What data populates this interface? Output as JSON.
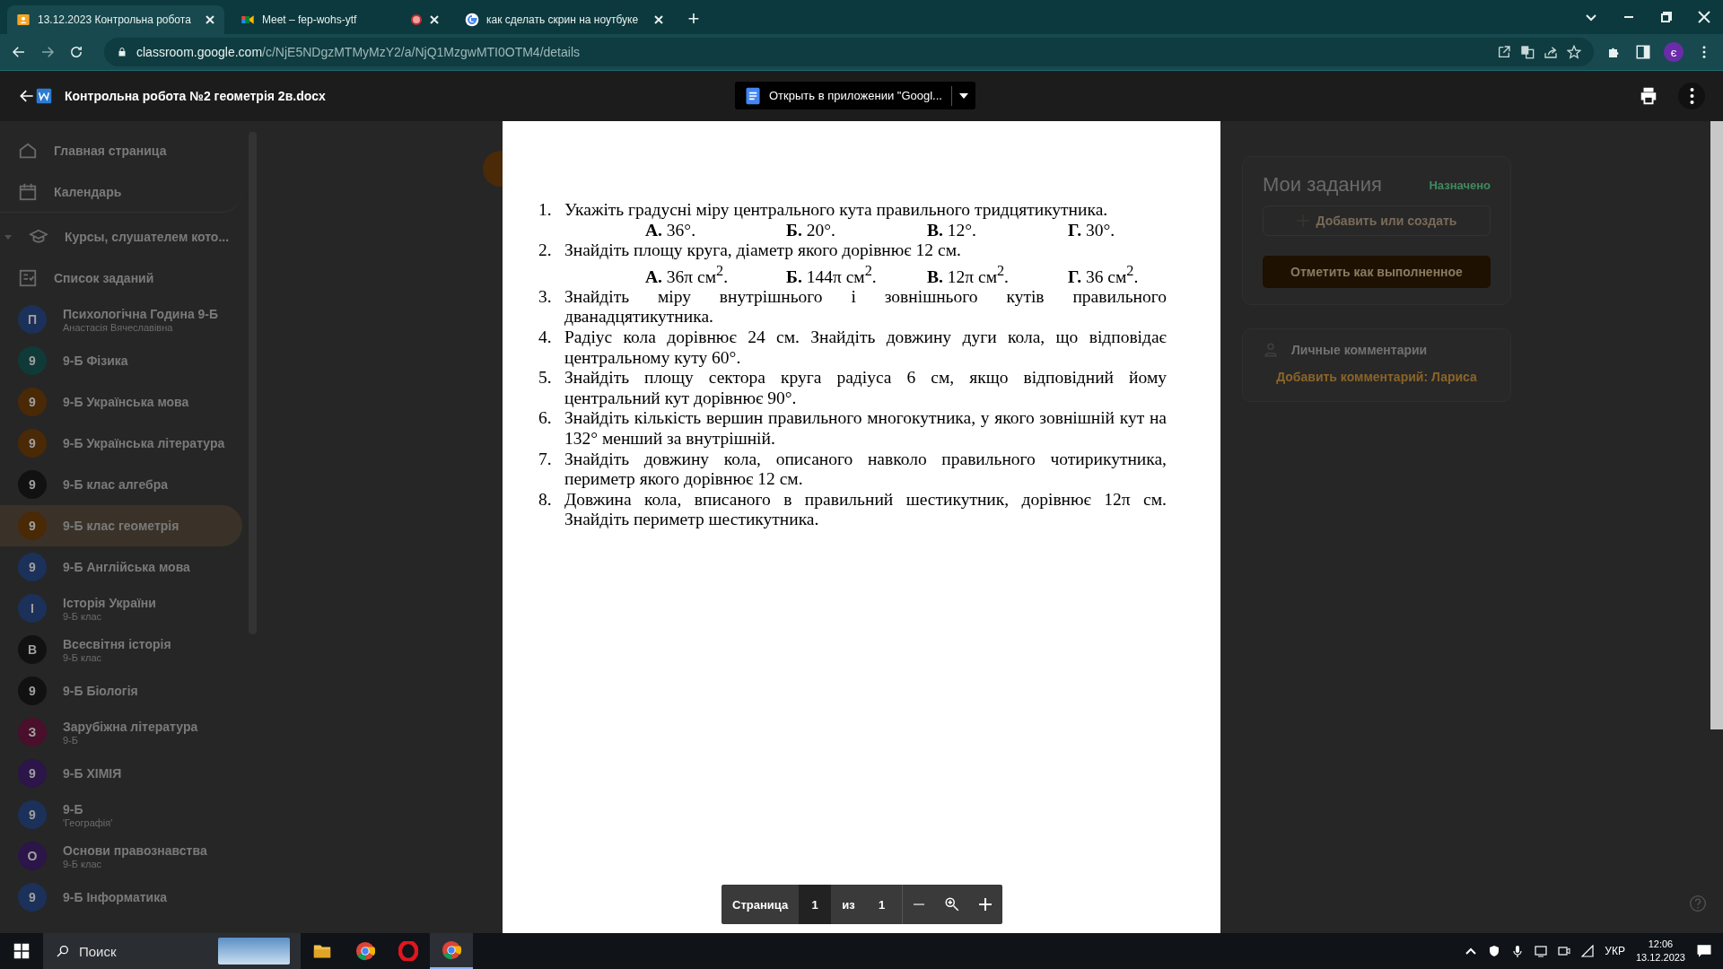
{
  "browser": {
    "tabs": [
      {
        "title": "13.12.2023 Контрольна робота",
        "selected": true,
        "kind": "classroom",
        "recording": false
      },
      {
        "title": "Meet – fep-wohs-ytf",
        "selected": false,
        "kind": "meet",
        "recording": true
      },
      {
        "title": "как сделать скрин на ноутбуке",
        "selected": false,
        "kind": "google",
        "recording": false
      }
    ],
    "new_tab": "+",
    "url_host": "classroom.google.com",
    "url_path": "/c/NjE5NDgzMTMyMzY2/a/NjQ1MzgwMTI0OTM4/details",
    "profile": "є"
  },
  "viewer": {
    "file_name": "Контрольна робота №2 геометрія 2в.docx",
    "open_button": "Открыть в приложении \"Googl...",
    "page_label": "Страница",
    "page": "1",
    "of": "из",
    "pages": "1"
  },
  "sidebar": {
    "items": [
      {
        "kind": "home",
        "label": "Главная страница",
        "selected": false
      },
      {
        "kind": "calendar",
        "label": "Календарь",
        "selected": false
      },
      {
        "kind": "courses",
        "label": "Курсы, слушателем кото...",
        "selected": false,
        "expanded": true
      },
      {
        "kind": "todo",
        "label": "Список заданий",
        "selected": false
      },
      {
        "kind": "course",
        "letter": "П",
        "color": "#1b3159",
        "label": "Психологічна Година 9-Б",
        "subtitle": "Анастасія Вячеславівна",
        "selected": false
      },
      {
        "kind": "course",
        "letter": "9",
        "color": "#0f3a38",
        "label": "9-Б Фізика",
        "selected": false
      },
      {
        "kind": "course",
        "letter": "9",
        "color": "#4a2906",
        "label": "9-Б Українська мова",
        "selected": false
      },
      {
        "kind": "course",
        "letter": "9",
        "color": "#4a2906",
        "label": "9-Б Українська література",
        "selected": false
      },
      {
        "kind": "course",
        "letter": "9",
        "color": "#111111",
        "label": "9-Б клас алгебра",
        "selected": false
      },
      {
        "kind": "course",
        "letter": "9",
        "color": "#4a2906",
        "label": "9-Б клас геометрія",
        "selected": true
      },
      {
        "kind": "course",
        "letter": "9",
        "color": "#1b3159",
        "label": "9-Б Англійська мова",
        "selected": false
      },
      {
        "kind": "course",
        "letter": "І",
        "color": "#1b3159",
        "label": "Історія України",
        "subtitle": "9-Б клас",
        "selected": false
      },
      {
        "kind": "course",
        "letter": "В",
        "color": "#111111",
        "label": "Всесвітня історія",
        "subtitle": "9-Б клас",
        "selected": false
      },
      {
        "kind": "course",
        "letter": "9",
        "color": "#111111",
        "label": "9-Б Біологія",
        "selected": false
      },
      {
        "kind": "course",
        "letter": "З",
        "color": "#4a0f2b",
        "label": "Зарубіжна література",
        "subtitle": "9-Б",
        "selected": false
      },
      {
        "kind": "course",
        "letter": "9",
        "color": "#2c1548",
        "label": "9-Б ХІМІЯ",
        "selected": false
      },
      {
        "kind": "course",
        "letter": "9",
        "color": "#1b3159",
        "label": "9-Б",
        "subtitle": "'Географія'",
        "selected": false
      },
      {
        "kind": "course",
        "letter": "О",
        "color": "#2c1548",
        "label": "Основи правознавства",
        "subtitle": "9-Б клас",
        "selected": false
      },
      {
        "kind": "course",
        "letter": "9",
        "color": "#1b3159",
        "label": "9-Б Інформатика",
        "selected": false
      }
    ]
  },
  "document": {
    "questions": [
      {
        "number": "1.",
        "text": "Укажіть градусні міру центрального кута правильного тридцятикутника.",
        "options": [
          "**А.** 36°.",
          "**Б.** 20°.",
          "**В.** 12°.",
          "**Г.** 30°."
        ]
      },
      {
        "number": "2.",
        "text": "Знайдіть площу круга, діаметр якого дорівнює 12 см.",
        "options": [
          "**А.** 36π см$^{2}$.",
          "**Б.** 144π см$^{2}$.",
          "**В.** 12π см$^{2}$.",
          "**Г.** 36 см$^{2}$."
        ]
      },
      {
        "number": "3.",
        "text": "Знайдіть міру внутрішнього і зовнішнього кутів правильного дванадцятикутника."
      },
      {
        "number": "4.",
        "text": "Радіус кола дорівнює 24 см. Знайдіть довжину дуги кола, що відповідає центральному куту 60°."
      },
      {
        "number": "5.",
        "text": "Знайдіть площу сектора круга радіуса 6 см, якщо відповідний йому центральний кут дорівнює 90°."
      },
      {
        "number": "6.",
        "text": "Знайдіть кількість вершин правильного многокутника, у якого зовнішній кут на 132° менший за внутрішній."
      },
      {
        "number": "7.",
        "text": "Знайдіть довжину кола, описаного навколо правильного чотирикутника, периметр якого дорівнює 12 см."
      },
      {
        "number": "8.",
        "text": "Довжина кола, вписаного в правильний шестикутник, дорівнює 12π см. Знайдіть периметр шестикутника."
      }
    ]
  },
  "right_panel": {
    "title": "Мои задания",
    "status": "Назначено",
    "add_button": "Добавить или создать",
    "done_button": "Отметить как выполненное",
    "comments_title": "Личные комментарии",
    "comment_link": "Добавить комментарий: Лариса"
  },
  "taskbar": {
    "search_placeholder": "Поиск",
    "language": "УКР",
    "time": "12:06",
    "date": "13.12.2023"
  }
}
